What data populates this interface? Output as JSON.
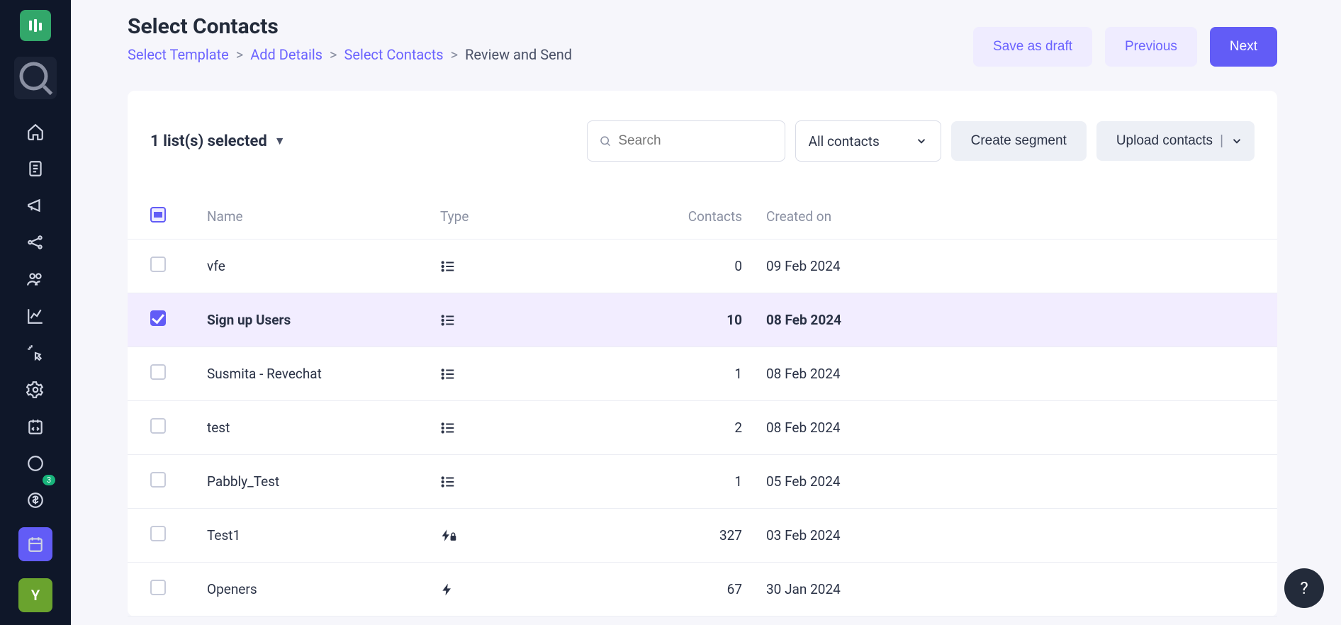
{
  "header": {
    "title": "Select Contacts",
    "breadcrumb": [
      {
        "label": "Select Template",
        "active": false
      },
      {
        "label": "Add Details",
        "active": false
      },
      {
        "label": "Select Contacts",
        "active": false
      },
      {
        "label": "Review and Send",
        "active": true
      }
    ],
    "save_draft": "Save as draft",
    "previous": "Previous",
    "next": "Next"
  },
  "toolbar": {
    "selected_text": "1 list(s) selected",
    "search_placeholder": "Search",
    "filter_value": "All contacts",
    "create_segment": "Create segment",
    "upload_contacts": "Upload contacts"
  },
  "table": {
    "columns": {
      "name": "Name",
      "type": "Type",
      "contacts": "Contacts",
      "created_on": "Created on"
    },
    "rows": [
      {
        "name": "vfe",
        "type": "list",
        "contacts": "0",
        "created_on": "09 Feb 2024",
        "selected": false
      },
      {
        "name": "Sign up Users",
        "type": "list",
        "contacts": "10",
        "created_on": "08 Feb 2024",
        "selected": true
      },
      {
        "name": "Susmita - Revechat",
        "type": "list",
        "contacts": "1",
        "created_on": "08 Feb 2024",
        "selected": false
      },
      {
        "name": "test",
        "type": "list",
        "contacts": "2",
        "created_on": "08 Feb 2024",
        "selected": false
      },
      {
        "name": "Pabbly_Test",
        "type": "list",
        "contacts": "1",
        "created_on": "05 Feb 2024",
        "selected": false
      },
      {
        "name": "Test1",
        "type": "bolt-lock",
        "contacts": "327",
        "created_on": "03 Feb 2024",
        "selected": false
      },
      {
        "name": "Openers",
        "type": "bolt",
        "contacts": "67",
        "created_on": "30 Jan 2024",
        "selected": false
      }
    ]
  },
  "sidebar": {
    "badge_count": "3",
    "user_initial": "Y"
  }
}
